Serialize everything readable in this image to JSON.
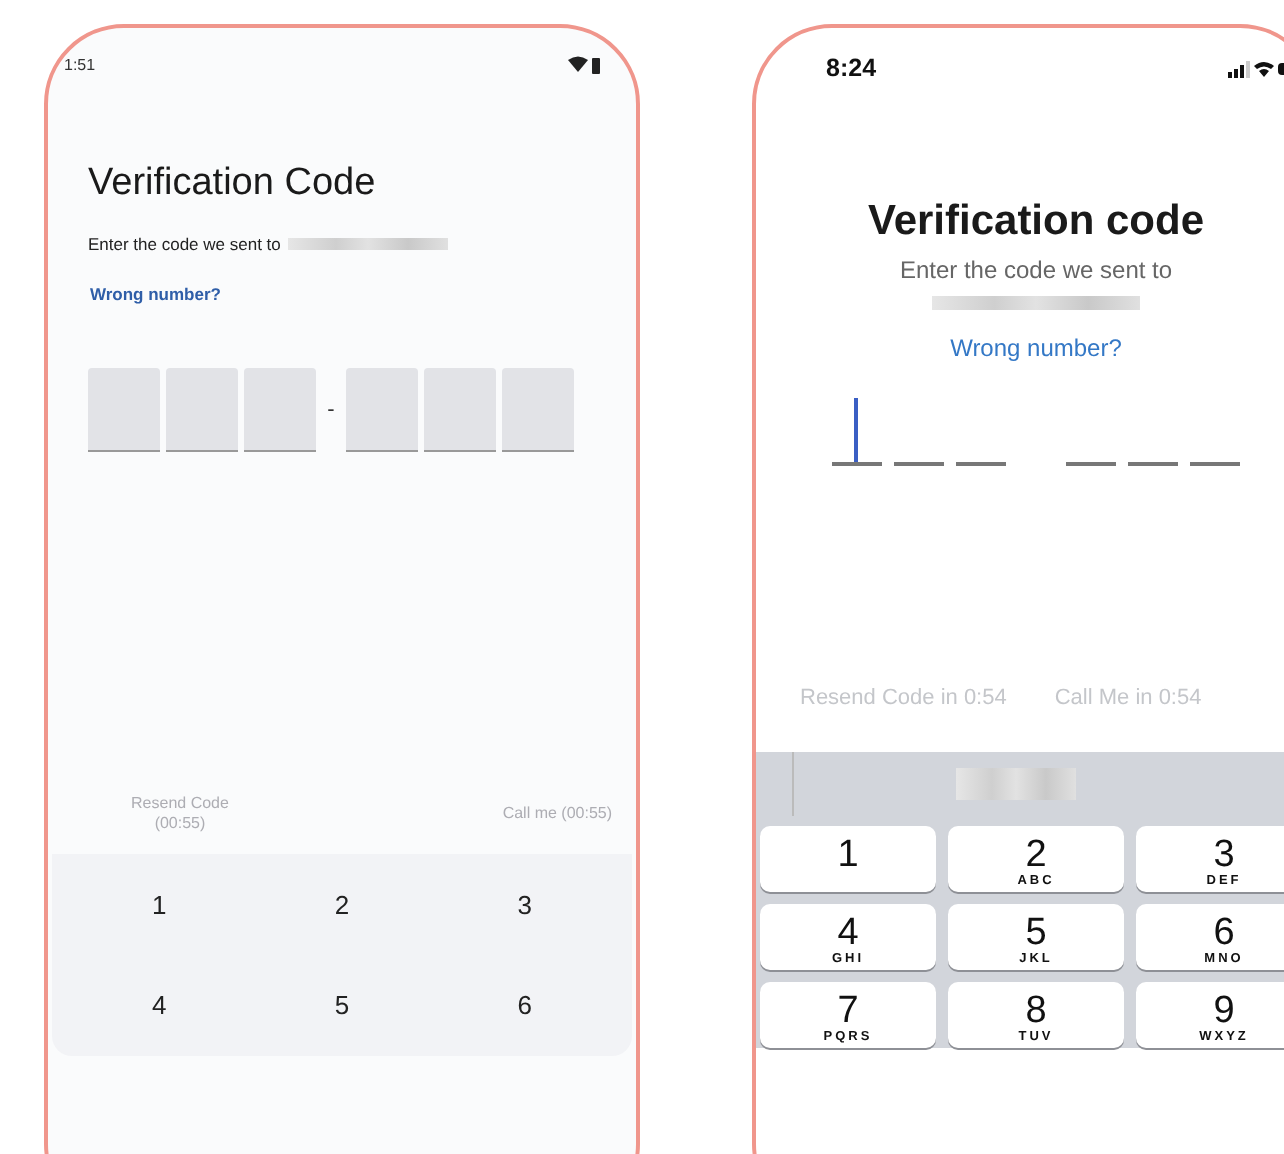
{
  "android_screen": {
    "status_time": "1:51",
    "title": "Verification Code",
    "prompt": "Enter the code we sent to",
    "link": "Wrong number?",
    "code_slots": [
      {
        "focused": false
      },
      {
        "focused": false
      },
      {
        "focused": false
      },
      {
        "focused": false
      },
      {
        "focused": false
      },
      {
        "focused": false
      }
    ],
    "separator": "-",
    "actions": [
      {
        "label": "Resend Code (00:55)",
        "disabled": true
      },
      {
        "label": "Call me (00:55)",
        "disabled": true
      }
    ],
    "keys": [
      {
        "digit": "1"
      },
      {
        "digit": "2"
      },
      {
        "digit": "3"
      },
      {
        "digit": "4"
      },
      {
        "digit": "5"
      },
      {
        "digit": "6"
      }
    ]
  },
  "ios_screen": {
    "status_time": "8:24",
    "title": "Verification code",
    "prompt": "Enter the code we sent to",
    "link": "Wrong number?",
    "code_slots": [
      {
        "focused": true
      },
      {
        "focused": false
      },
      {
        "focused": false
      },
      {
        "focused": false
      },
      {
        "focused": false
      },
      {
        "focused": false
      }
    ],
    "actions": [
      {
        "label": "Resend Code in 0:54",
        "disabled": true
      },
      {
        "label": "Call Me in 0:54",
        "disabled": true
      }
    ],
    "keys": [
      {
        "digit": "1"
      },
      {
        "digit": "2",
        "letters": "ABC"
      },
      {
        "digit": "3",
        "letters": "DEF"
      },
      {
        "digit": "4",
        "letters": "GHI"
      },
      {
        "digit": "5",
        "letters": "JKL"
      },
      {
        "digit": "6",
        "letters": "MNO"
      },
      {
        "digit": "7",
        "letters": "PQRS"
      },
      {
        "digit": "8",
        "letters": "TUV"
      },
      {
        "digit": "9",
        "letters": "WXYZ"
      }
    ]
  }
}
